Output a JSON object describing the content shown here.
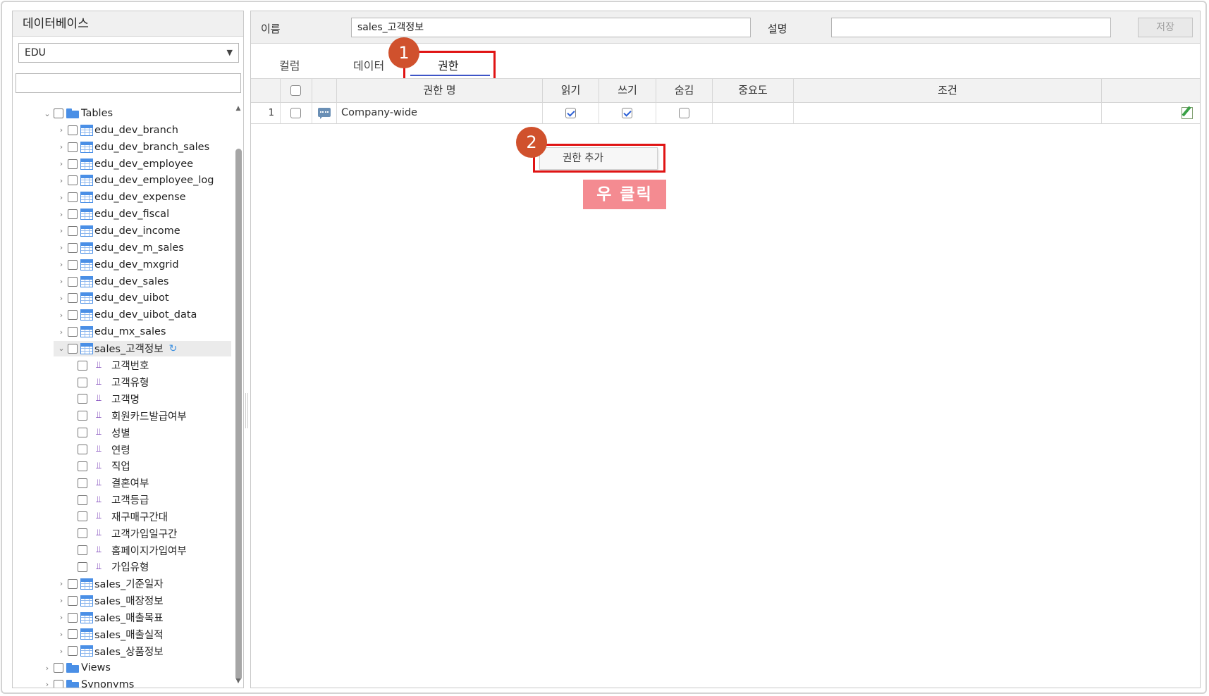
{
  "sidebar": {
    "title": "데이터베이스",
    "db_select": "EDU",
    "search_placeholder": "",
    "tree": [
      {
        "label": "Tables",
        "type": "folder",
        "level": 0,
        "expanded": true
      },
      {
        "label": "edu_dev_branch",
        "type": "table",
        "level": 1
      },
      {
        "label": "edu_dev_branch_sales",
        "type": "table",
        "level": 1
      },
      {
        "label": "edu_dev_employee",
        "type": "table",
        "level": 1
      },
      {
        "label": "edu_dev_employee_log",
        "type": "table",
        "level": 1
      },
      {
        "label": "edu_dev_expense",
        "type": "table",
        "level": 1
      },
      {
        "label": "edu_dev_fiscal",
        "type": "table",
        "level": 1
      },
      {
        "label": "edu_dev_income",
        "type": "table",
        "level": 1
      },
      {
        "label": "edu_dev_m_sales",
        "type": "table",
        "level": 1
      },
      {
        "label": "edu_dev_mxgrid",
        "type": "table",
        "level": 1
      },
      {
        "label": "edu_dev_sales",
        "type": "table",
        "level": 1
      },
      {
        "label": "edu_dev_uibot",
        "type": "table",
        "level": 1
      },
      {
        "label": "edu_dev_uibot_data",
        "type": "table",
        "level": 1
      },
      {
        "label": "edu_mx_sales",
        "type": "table",
        "level": 1
      },
      {
        "label": "sales_고객정보",
        "type": "table",
        "level": 1,
        "expanded": true,
        "selected": true
      },
      {
        "label": "고객번호",
        "type": "column",
        "level": 2
      },
      {
        "label": "고객유형",
        "type": "column",
        "level": 2
      },
      {
        "label": "고객명",
        "type": "column",
        "level": 2
      },
      {
        "label": "회원카드발급여부",
        "type": "column",
        "level": 2
      },
      {
        "label": "성별",
        "type": "column",
        "level": 2
      },
      {
        "label": "연령",
        "type": "column",
        "level": 2
      },
      {
        "label": "직업",
        "type": "column",
        "level": 2
      },
      {
        "label": "결혼여부",
        "type": "column",
        "level": 2
      },
      {
        "label": "고객등급",
        "type": "column",
        "level": 2
      },
      {
        "label": "재구매구간대",
        "type": "column",
        "level": 2
      },
      {
        "label": "고객가입일구간",
        "type": "column",
        "level": 2
      },
      {
        "label": "홈페이지가입여부",
        "type": "column",
        "level": 2
      },
      {
        "label": "가입유형",
        "type": "column",
        "level": 2
      },
      {
        "label": "sales_기준일자",
        "type": "table",
        "level": 1
      },
      {
        "label": "sales_매장정보",
        "type": "table",
        "level": 1
      },
      {
        "label": "sales_매출목표",
        "type": "table",
        "level": 1
      },
      {
        "label": "sales_매출실적",
        "type": "table",
        "level": 1
      },
      {
        "label": "sales_상품정보",
        "type": "table",
        "level": 1
      },
      {
        "label": "Views",
        "type": "folder",
        "level": 0
      },
      {
        "label": "Synonyms",
        "type": "folder",
        "level": 0
      }
    ]
  },
  "main": {
    "name_label": "이름",
    "name_value": "sales_고객정보",
    "desc_label": "설명",
    "desc_value": "",
    "save_label": "저장",
    "tabs": [
      "컬럼",
      "데이터",
      "권한"
    ],
    "active_tab": "권한",
    "grid": {
      "headers": [
        "권한 명",
        "읽기",
        "쓰기",
        "숨김",
        "중요도",
        "조건"
      ],
      "rows": [
        {
          "num": "1",
          "name": "Company-wide",
          "read": true,
          "write": true,
          "hide": false,
          "importance": "",
          "condition": ""
        }
      ]
    },
    "context_menu": {
      "item": "권한 추가"
    },
    "annotations": {
      "step1": "1",
      "step2": "2",
      "right_click": "우 클릭"
    }
  },
  "colors": {
    "highlight_red": "#e01414",
    "badge": "#d0512d",
    "right_click_label": "#f48b91",
    "accent_blue": "#3e55c7"
  }
}
